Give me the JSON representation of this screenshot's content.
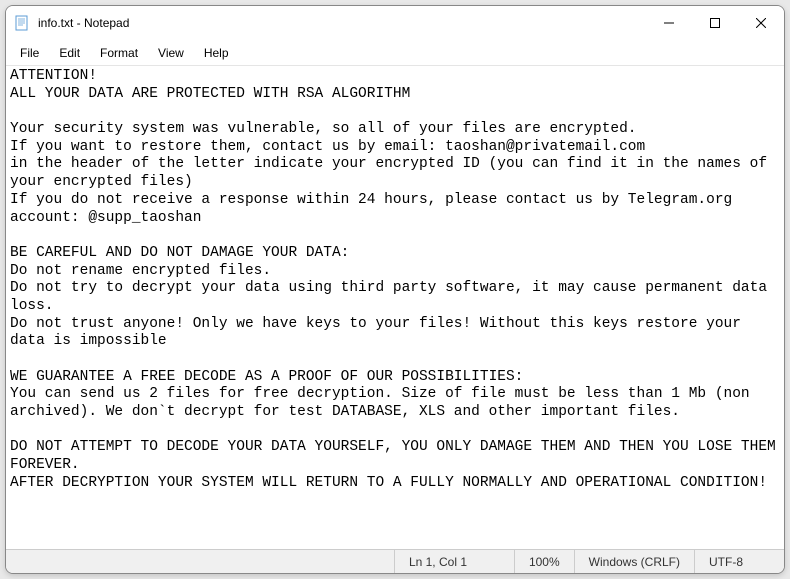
{
  "titlebar": {
    "title": "info.txt - Notepad"
  },
  "menu": {
    "file": "File",
    "edit": "Edit",
    "format": "Format",
    "view": "View",
    "help": "Help"
  },
  "content": "ATTENTION!\nALL YOUR DATA ARE PROTECTED WITH RSA ALGORITHM\n\nYour security system was vulnerable, so all of your files are encrypted.\nIf you want to restore them, contact us by email: taoshan@privatemail.com\nin the header of the letter indicate your encrypted ID (you can find it in the names of your encrypted files)\nIf you do not receive a response within 24 hours, please contact us by Telegram.org account: @supp_taoshan\n\nBE CAREFUL AND DO NOT DAMAGE YOUR DATA:\nDo not rename encrypted files.\nDo not try to decrypt your data using third party software, it may cause permanent data loss.\nDo not trust anyone! Only we have keys to your files! Without this keys restore your data is impossible\n\nWE GUARANTEE A FREE DECODE AS A PROOF OF OUR POSSIBILITIES:\nYou can send us 2 files for free decryption. Size of file must be less than 1 Mb (non archived). We don`t decrypt for test DATABASE, XLS and other important files.\n\nDO NOT ATTEMPT TO DECODE YOUR DATA YOURSELF, YOU ONLY DAMAGE THEM AND THEN YOU LOSE THEM FOREVER.\nAFTER DECRYPTION YOUR SYSTEM WILL RETURN TO A FULLY NORMALLY AND OPERATIONAL CONDITION!",
  "statusbar": {
    "position": "Ln 1, Col 1",
    "zoom": "100%",
    "lineending": "Windows (CRLF)",
    "encoding": "UTF-8"
  }
}
